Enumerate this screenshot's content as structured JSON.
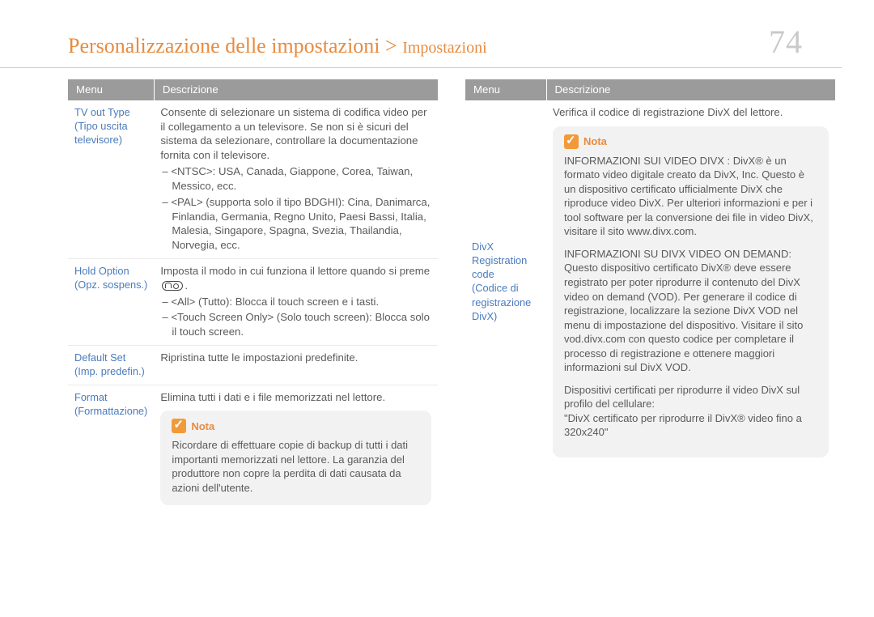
{
  "header": {
    "breadcrumb_main": "Personalizzazione delle impostazioni >",
    "breadcrumb_sub": "Impostazioni",
    "page_number": "74"
  },
  "table_headers": {
    "menu": "Menu",
    "desc": "Descrizione"
  },
  "left_rows": [
    {
      "menu": "TV out Type\n(Tipo uscita televisore)",
      "desc_intro": "Consente di selezionare un sistema di codifica video per il collegamento a un televisore. Se non si è sicuri del sistema da selezionare, controllare la documentazione fornita con il televisore.",
      "items": [
        "– <NTSC>: USA, Canada, Giappone, Corea, Taiwan, Messico, ecc.",
        "– <PAL> (supporta solo il tipo BDGHI): Cina, Danimarca, Finlandia, Germania, Regno Unito, Paesi Bassi, Italia, Malesia, Singapore, Spagna, Svezia, Thailandia, Norvegia, ecc."
      ]
    },
    {
      "menu": "Hold Option\n(Opz. sospens.)",
      "desc_intro": "Imposta il modo in cui funziona il lettore quando si preme",
      "has_lock_icon": true,
      "items": [
        "– <All> (Tutto): Blocca il touch screen e i tasti.",
        "– <Touch Screen Only> (Solo touch screen): Blocca solo il touch screen."
      ]
    },
    {
      "menu": "Default Set\n(Imp. predefin.)",
      "desc_intro": "Ripristina tutte le impostazioni predefinite."
    },
    {
      "menu": "Format\n(Formattazione)",
      "desc_intro": "Elimina tutti i dati e i file memorizzati nel lettore.",
      "note_label": "Nota",
      "note_text": "Ricordare di effettuare copie di backup di tutti i dati importanti memorizzati nel lettore. La garanzia del produttore non copre la perdita di dati causata da azioni dell'utente."
    }
  ],
  "right_rows": [
    {
      "menu": "DivX Registration code\n(Codice di registrazione DivX)",
      "desc_intro": "Verifica il codice di registrazione DivX del lettore.",
      "note_label": "Nota",
      "note_paras": [
        "INFORMAZIONI SUI VIDEO DIVX : DivX® è un formato video digitale creato da DivX, Inc. Questo è un dispositivo certificato ufficialmente DivX che riproduce video DivX. Per ulteriori informazioni e per i tool software per la conversione dei file in video DivX, visitare il sito www.divx.com.",
        "INFORMAZIONI SU DIVX VIDEO ON DEMAND: Questo dispositivo certificato DivX® deve essere registrato per poter riprodurre il contenuto del DivX video on demand (VOD). Per generare il codice di registrazione, localizzare la sezione DivX VOD nel menu di impostazione del dispositivo. Visitare il sito vod.divx.com con questo codice per completare il processo di registrazione e ottenere maggiori informazioni sul DivX VOD.",
        "Dispositivi certificati per riprodurre il video DivX sul profilo del cellulare:\n\"DivX certificato per riprodurre il DivX® video fino a 320x240\""
      ]
    }
  ]
}
